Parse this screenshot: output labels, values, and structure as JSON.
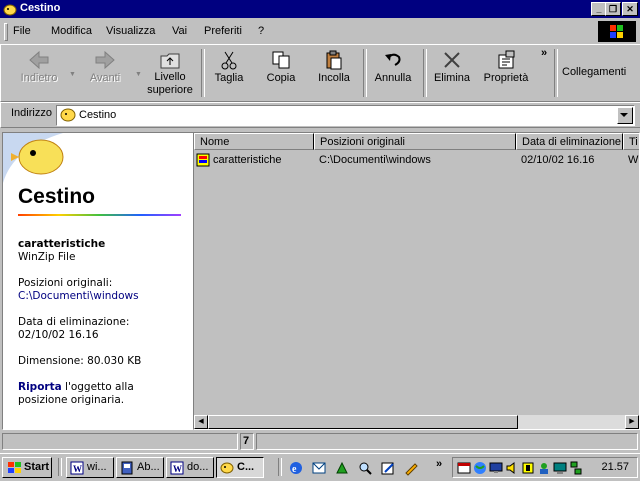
{
  "window": {
    "title": "Cestino"
  },
  "menu": [
    "File",
    "Modifica",
    "Visualizza",
    "Vai",
    "Preferiti",
    "?"
  ],
  "toolbar": {
    "back": "Indietro",
    "forward": "Avanti",
    "up_line1": "Livello",
    "up_line2": "superiore",
    "cut": "Taglia",
    "copy": "Copia",
    "paste": "Incolla",
    "undo": "Annulla",
    "delete": "Elimina",
    "properties": "Proprietà",
    "links": "Collegamenti"
  },
  "address": {
    "label": "Indirizzo",
    "value": "Cestino"
  },
  "panel": {
    "title": "Cestino",
    "item_name": "caratteristiche",
    "item_type": "WinZip File",
    "orig_label": "Posizioni originali:",
    "orig_value": "C:\\Documenti\\windows",
    "del_label": "Data di eliminazione:",
    "del_value": "02/10/02 16.16",
    "size_text": "Dimensione: 80.030 KB",
    "restore_link": "Riporta",
    "restore_text_1": " l'oggetto alla",
    "restore_text_2": "posizione originaria."
  },
  "columns": [
    "Nome",
    "Posizioni originali",
    "Data di eliminazione",
    "Ti"
  ],
  "rows": [
    {
      "name": "caratteristiche",
      "location": "C:\\Documenti\\windows",
      "date": "02/10/02 16.16",
      "type": "Wi"
    }
  ],
  "status": {
    "count": "7"
  },
  "taskbar": {
    "start": "Start",
    "buttons": [
      "wi...",
      "Ab...",
      "do...",
      "C..."
    ],
    "chevron": "»",
    "clock": "21.57"
  },
  "icons": {
    "window": "recycle-bin-icon",
    "back": "back-arrow-icon",
    "forward": "forward-arrow-icon",
    "up": "up-folder-icon",
    "cut": "scissors-icon",
    "copy": "copy-icon",
    "paste": "paste-icon",
    "undo": "undo-icon",
    "delete": "delete-x-icon",
    "properties": "properties-icon"
  },
  "colors": {
    "titlebar": "#000080",
    "face": "#c0c0c0",
    "link": "#000080"
  }
}
